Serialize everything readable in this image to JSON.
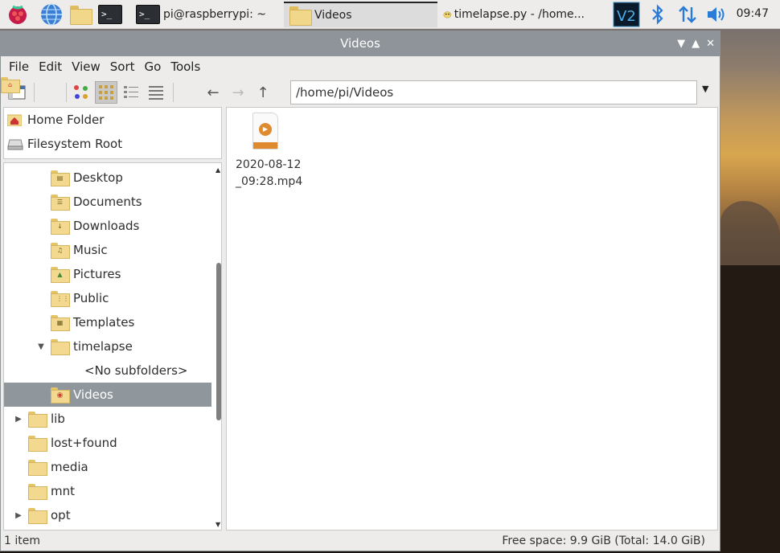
{
  "taskbar": {
    "tasks": [
      {
        "label": "pi@raspberrypi: ~"
      },
      {
        "label": "Videos"
      },
      {
        "label": "timelapse.py - /home..."
      }
    ],
    "clock": "09:47"
  },
  "window": {
    "title": "Videos",
    "menu": [
      "File",
      "Edit",
      "View",
      "Sort",
      "Go",
      "Tools"
    ],
    "path": "/home/pi/Videos"
  },
  "places": [
    {
      "label": "Home Folder"
    },
    {
      "label": "Filesystem Root"
    }
  ],
  "tree": [
    {
      "label": "Desktop"
    },
    {
      "label": "Documents"
    },
    {
      "label": "Downloads"
    },
    {
      "label": "Music"
    },
    {
      "label": "Pictures"
    },
    {
      "label": "Public"
    },
    {
      "label": "Templates"
    },
    {
      "label": "timelapse"
    },
    {
      "label": "<No subfolders>"
    },
    {
      "label": "Videos"
    },
    {
      "label": "lib"
    },
    {
      "label": "lost+found"
    },
    {
      "label": "media"
    },
    {
      "label": "mnt"
    },
    {
      "label": "opt"
    }
  ],
  "files": [
    {
      "name": "2020-08-12\n_09:28.mp4"
    }
  ],
  "status": {
    "left": "1 item",
    "right": "Free space: 9.9 GiB (Total: 14.0 GiB)"
  },
  "colors": {
    "selection": "#8f979d",
    "titlebar": "#8e9499",
    "video_accent": "#e08a30"
  }
}
